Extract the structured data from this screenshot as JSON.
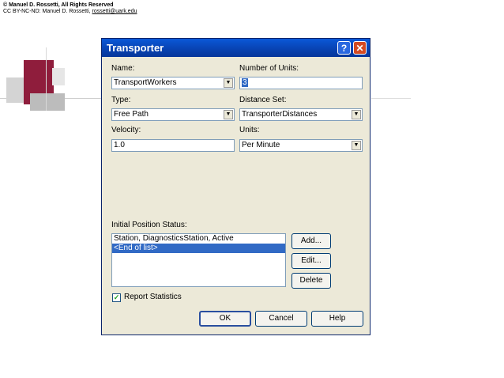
{
  "copyright": {
    "line1": "© Manuel D. Rossetti, All Rights Reserved",
    "line2_prefix": "CC BY-NC-ND: Manuel D. Rossetti, ",
    "email": "rossetti@uark.edu"
  },
  "dialog": {
    "title": "Transporter",
    "help_glyph": "?",
    "close_glyph": "✕",
    "name_label": "Name:",
    "name_value": "TransportWorkers",
    "units_count_label": "Number of Units:",
    "units_count_value": "3",
    "type_label": "Type:",
    "type_value": "Free Path",
    "distance_label": "Distance Set:",
    "distance_value": "TransporterDistances",
    "velocity_label": "Velocity:",
    "velocity_value": "1.0",
    "units_label": "Units:",
    "units_value": "Per Minute",
    "initial_label": "Initial Position Status:",
    "list_items": [
      "Station, DiagnosticsStation, Active",
      "<End of list>"
    ],
    "add_label": "Add...",
    "edit_label": "Edit...",
    "delete_label": "Delete",
    "report_label": "Report Statistics",
    "report_checked": true,
    "ok_label": "OK",
    "cancel_label": "Cancel",
    "help_label": "Help"
  },
  "colors": {
    "titlebar": "#0842b0",
    "dialog_bg": "#ece9d8",
    "selection": "#316ac5",
    "accent_square": "#8f1d3c"
  }
}
